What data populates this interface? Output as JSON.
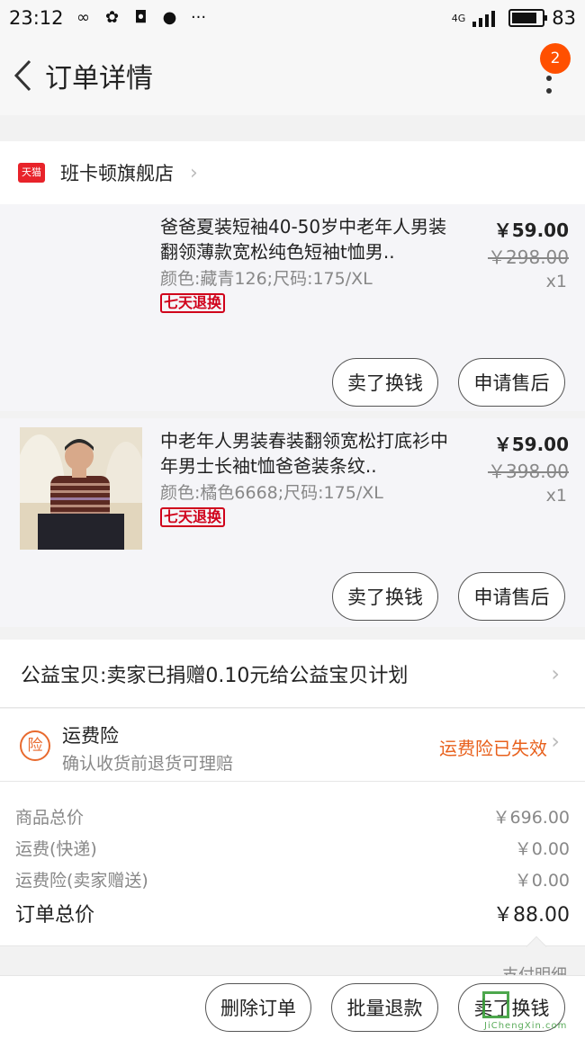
{
  "status_bar": {
    "time": "23:12",
    "network": "4G",
    "battery_percent": "83",
    "battery_level": 0.83
  },
  "header": {
    "title": "订单详情",
    "badge_count": "2"
  },
  "shop": {
    "platform_logo": "天猫",
    "name": "班卡顿旗舰店"
  },
  "items": [
    {
      "title": "爸爸夏装短袖40-50岁中老年人男装翻领薄款宽松纯色短袖t恤男..",
      "sku": "颜色:藏青126;尺码:175/XL",
      "tag": "七天退换",
      "price": "￥59.00",
      "original_price": "￥298.00",
      "quantity": "x1",
      "sell_button": "卖了换钱",
      "aftersale_button": "申请售后"
    },
    {
      "title": "中老年人男装春装翻领宽松打底衫中年男士长袖t恤爸爸装条纹..",
      "sku": "颜色:橘色6668;尺码:175/XL",
      "tag": "七天退换",
      "price": "￥59.00",
      "original_price": "￥398.00",
      "quantity": "x1",
      "sell_button": "卖了换钱",
      "aftersale_button": "申请售后"
    }
  ],
  "charity": {
    "text": "公益宝贝:卖家已捐赠0.10元给公益宝贝计划"
  },
  "shipping_insurance": {
    "icon_label": "险",
    "title": "运费险",
    "subtitle": "确认收货前退货可理赔",
    "status": "运费险已失效"
  },
  "summary": {
    "goods_total_label": "商品总价",
    "goods_total_value": "￥696.00",
    "shipping_label": "运费(快递)",
    "shipping_value": "￥0.00",
    "insurance_label": "运费险(卖家赠送)",
    "insurance_value": "￥0.00",
    "order_total_label": "订单总价",
    "order_total_value": "￥88.00"
  },
  "pay_info_label": "支付明细",
  "bottom_bar": {
    "delete_order": "删除订单",
    "batch_refund": "批量退款",
    "sell": "卖了换钱"
  },
  "watermark": {
    "text": "JiChengXin.com"
  },
  "colors": {
    "accent_orange": "#ff5000",
    "tag_red": "#d0021b",
    "tmall_red": "#e8232a"
  }
}
